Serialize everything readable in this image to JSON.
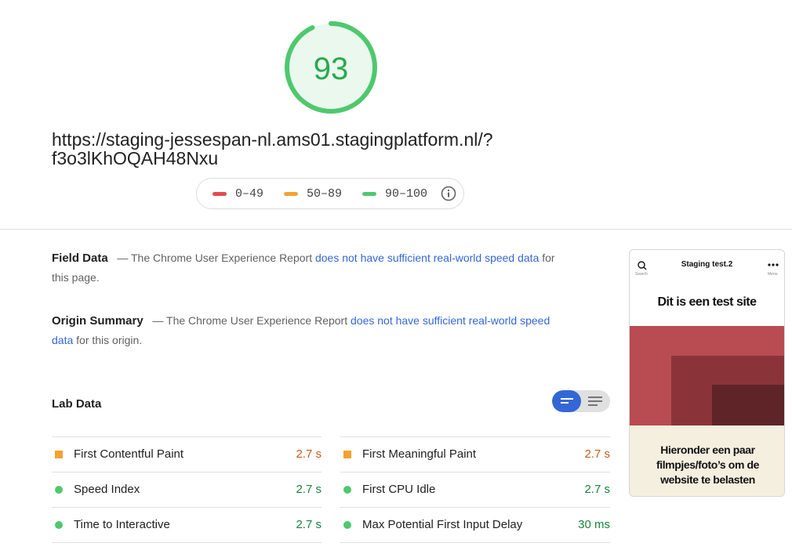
{
  "score": {
    "value": "93",
    "fraction": 0.93,
    "color": "#0cce6b"
  },
  "url": {
    "line1": "https://staging-jessespan-nl.ams01.stagingplatform.nl/?",
    "line2": "f3o3lKhOQAH48Nxu"
  },
  "legend": {
    "items": [
      {
        "label": "0–49",
        "color": "#e24c4b"
      },
      {
        "label": "50–89",
        "color": "#f4a230"
      },
      {
        "label": "90–100",
        "color": "#4fc86e"
      }
    ],
    "info_icon": "info-icon"
  },
  "field_data": {
    "title": "Field Data",
    "pre": "— The Chrome User Experience Report",
    "link": "does not have sufficient real-world speed data",
    "post": "for this page."
  },
  "origin_summary": {
    "title": "Origin Summary",
    "pre": "— The Chrome User Experience Report",
    "link": "does not have sufficient real-world speed data",
    "post": "for this origin."
  },
  "lab_data": {
    "title": "Lab Data",
    "left": [
      {
        "name": "First Contentful Paint",
        "value": "2.7 s",
        "status": "average"
      },
      {
        "name": "Speed Index",
        "value": "2.7 s",
        "status": "pass"
      },
      {
        "name": "Time to Interactive",
        "value": "2.7 s",
        "status": "pass"
      }
    ],
    "right": [
      {
        "name": "First Meaningful Paint",
        "value": "2.7 s",
        "status": "average"
      },
      {
        "name": "First CPU Idle",
        "value": "2.7 s",
        "status": "pass"
      },
      {
        "name": "Max Potential First Input Delay",
        "value": "30 ms",
        "status": "pass"
      }
    ]
  },
  "screenshot": {
    "site_title": "Staging test.2",
    "search_label": "Search",
    "menu_label": "Menu",
    "hero": "Dit is een test site",
    "footer_text": [
      "Hieronder een paar",
      "filmpjes/foto’s om de",
      "website te belasten"
    ]
  }
}
